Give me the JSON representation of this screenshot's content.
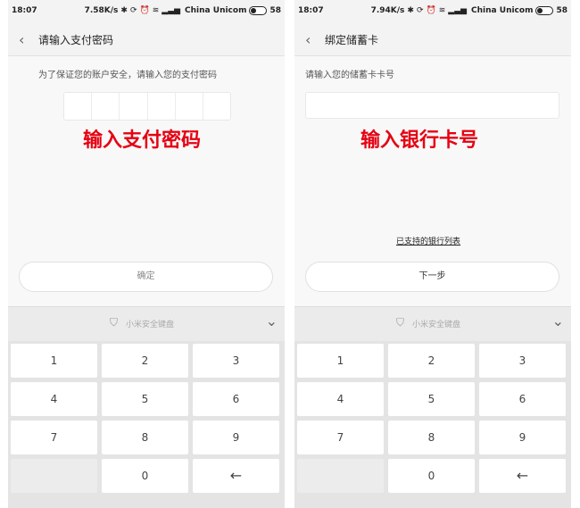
{
  "screens": [
    {
      "status": {
        "time": "18:07",
        "speed": "7.58K/s",
        "carrier": "China Unicom",
        "battery": "58"
      },
      "title": "请输入支付密码",
      "hint": "为了保证您的账户安全，请输入您的支付密码",
      "overlay": "输入支付密码",
      "button": "确定",
      "keyboard_title": "小米安全键盘",
      "keys": [
        "1",
        "2",
        "3",
        "4",
        "5",
        "6",
        "7",
        "8",
        "9",
        "",
        "0",
        "←"
      ]
    },
    {
      "status": {
        "time": "18:07",
        "speed": "7.94K/s",
        "carrier": "China Unicom",
        "battery": "58"
      },
      "title": "绑定储蓄卡",
      "hint": "请输入您的储蓄卡卡号",
      "overlay": "输入银行卡号",
      "link": "已支持的银行列表",
      "button": "下一步",
      "keyboard_title": "小米安全键盘",
      "keys": [
        "1",
        "2",
        "3",
        "4",
        "5",
        "6",
        "7",
        "8",
        "9",
        "",
        "0",
        "←"
      ]
    }
  ],
  "icons": {
    "back": "chevron-left-icon",
    "bluetooth": "bluetooth-icon",
    "alarm": "alarm-icon",
    "wifi": "wifi-icon",
    "signal": "signal-icon",
    "shield": "shield-icon",
    "collapse": "chevron-down-icon",
    "backspace": "backspace-icon"
  },
  "colors": {
    "overlay": "#e60012",
    "keypad_bg": "#e4e4e4",
    "screen_bg": "#f3f3f3"
  }
}
